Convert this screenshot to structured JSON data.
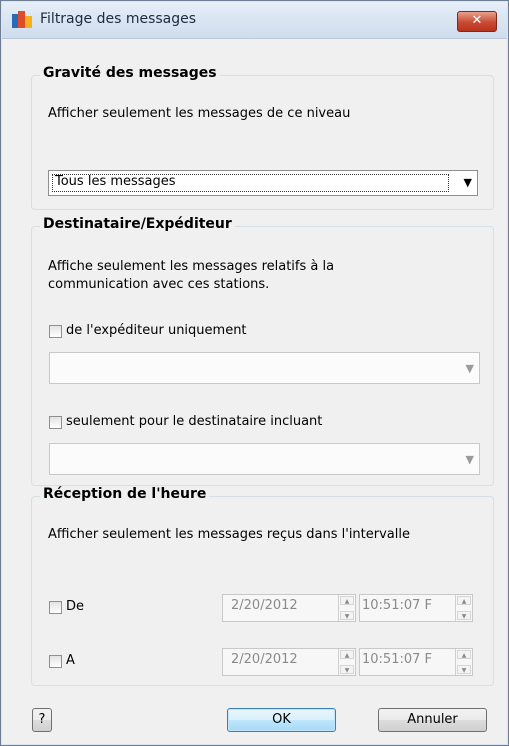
{
  "window": {
    "title": "Filtrage des messages",
    "close_label": "✕"
  },
  "severity": {
    "group_title": "Gravité des messages",
    "description": "Afficher seulement les messages de ce niveau",
    "selected": "Tous les messages"
  },
  "recipient": {
    "group_title": "Destinataire/Expéditeur",
    "description_line1": "Affiche seulement les messages relatifs à la",
    "description_line2": "communication avec ces stations.",
    "sender_checkbox_label": "de l'expéditeur uniquement",
    "recipient_checkbox_label": "seulement pour le destinataire incluant"
  },
  "time": {
    "group_title": "Réception de l'heure",
    "description": "Afficher seulement les messages reçus dans l'intervalle",
    "from_label": "De",
    "to_label": "A",
    "from_date": "2/20/2012",
    "from_time": "10:51:07 F",
    "to_date": "2/20/2012",
    "to_time": "10:51:07 F"
  },
  "buttons": {
    "help": "?",
    "ok": "OK",
    "cancel": "Annuler"
  }
}
